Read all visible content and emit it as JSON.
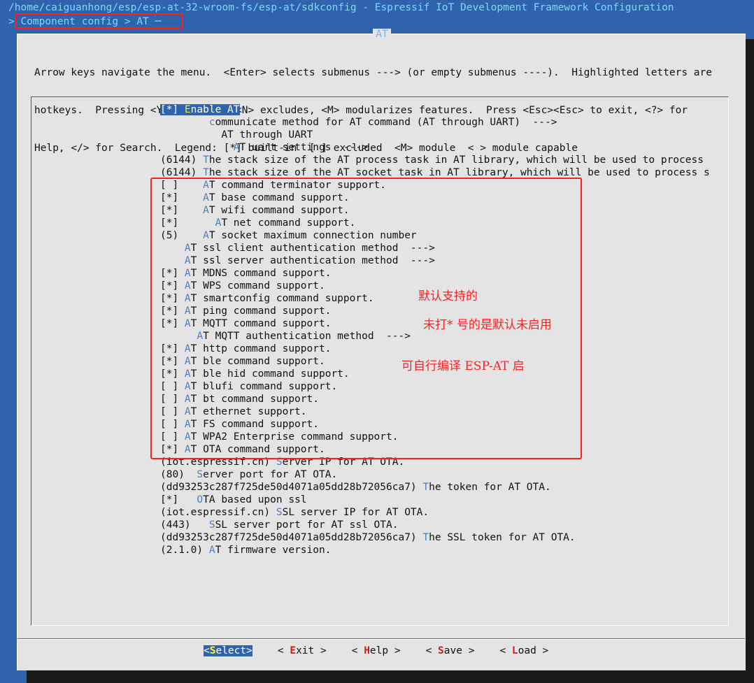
{
  "title_bar": "/home/caiguanhong/esp/esp-at-32-wroom-fs/esp-at/sdkconfig - Espressif IoT Development Framework Configuration",
  "breadcrumb": "> Component config > AT ─",
  "dialog_title": "AT",
  "help_lines": [
    "Arrow keys navigate the menu.  <Enter> selects submenus ---> (or empty submenus ----).  Highlighted letters are",
    "hotkeys.  Pressing <Y> includes, <N> excludes, <M> modularizes features.  Press <Esc><Esc> to exit, <?> for",
    "Help, </> for Search.  Legend: [*] built-in  [ ] excluded  <M> module  < > module capable"
  ],
  "menu_items": [
    {
      "pre": "[*] ",
      "hk": "E",
      "post": "nable AT",
      "selected": true
    },
    {
      "pre": "        ",
      "hk": "c",
      "post": "ommunicate method for AT command (AT through UART)  --->"
    },
    {
      "pre": "          ",
      "hk": "",
      "post": "AT through UART"
    },
    {
      "pre": "            ",
      "hk": "A",
      "post": "T uart settings  --->"
    },
    {
      "pre": "(6144) ",
      "hk": "T",
      "post": "he stack size of the AT process task in AT library, which will be used to process"
    },
    {
      "pre": "(6144) ",
      "hk": "T",
      "post": "he stack size of the AT socket task in AT library, which will be used to process s"
    },
    {
      "pre": "[ ]    ",
      "hk": "A",
      "post": "T command terminator support."
    },
    {
      "pre": "[*]    ",
      "hk": "A",
      "post": "T base command support."
    },
    {
      "pre": "[*]    ",
      "hk": "A",
      "post": "T wifi command support."
    },
    {
      "pre": "[*]      ",
      "hk": "A",
      "post": "T net command support."
    },
    {
      "pre": "(5)    ",
      "hk": "A",
      "post": "T socket maximum connection number"
    },
    {
      "pre": "    ",
      "hk": "A",
      "post": "T ssl client authentication method  --->"
    },
    {
      "pre": "    ",
      "hk": "A",
      "post": "T ssl server authentication method  --->"
    },
    {
      "pre": "[*] ",
      "hk": "A",
      "post": "T MDNS command support."
    },
    {
      "pre": "[*] ",
      "hk": "A",
      "post": "T WPS command support."
    },
    {
      "pre": "[*] ",
      "hk": "A",
      "post": "T smartconfig command support."
    },
    {
      "pre": "[*] ",
      "hk": "A",
      "post": "T ping command support."
    },
    {
      "pre": "[*] ",
      "hk": "A",
      "post": "T MQTT command support."
    },
    {
      "pre": "      ",
      "hk": "A",
      "post": "T MQTT authentication method  --->"
    },
    {
      "pre": "[*] ",
      "hk": "A",
      "post": "T http command support."
    },
    {
      "pre": "[*] ",
      "hk": "A",
      "post": "T ble command support."
    },
    {
      "pre": "[*] ",
      "hk": "A",
      "post": "T ble hid command support."
    },
    {
      "pre": "[ ] ",
      "hk": "A",
      "post": "T blufi command support."
    },
    {
      "pre": "[ ] ",
      "hk": "A",
      "post": "T bt command support."
    },
    {
      "pre": "[ ] ",
      "hk": "A",
      "post": "T ethernet support."
    },
    {
      "pre": "[ ] ",
      "hk": "A",
      "post": "T FS command support."
    },
    {
      "pre": "[ ] ",
      "hk": "A",
      "post": "T WPA2 Enterprise command support."
    },
    {
      "pre": "[*] ",
      "hk": "A",
      "post": "T OTA command support."
    },
    {
      "pre": "(iot.espressif.cn) ",
      "hk": "S",
      "post": "erver IP for AT OTA."
    },
    {
      "pre": "(80)  ",
      "hk": "S",
      "post": "erver port for AT OTA."
    },
    {
      "pre": "(dd93253c287f725de50d4071a05dd28b72056ca7) ",
      "hk": "T",
      "post": "he token for AT OTA."
    },
    {
      "pre": "[*]   ",
      "hk": "O",
      "post": "TA based upon ssl"
    },
    {
      "pre": "(iot.espressif.cn) ",
      "hk": "S",
      "post": "SL server IP for AT OTA."
    },
    {
      "pre": "(443)   ",
      "hk": "S",
      "post": "SL server port for AT ssl OTA."
    },
    {
      "pre": "(dd93253c287f725de50d4071a05dd28b72056ca7) ",
      "hk": "T",
      "post": "he SSL token for AT OTA."
    },
    {
      "pre": "(2.1.0) ",
      "hk": "A",
      "post": "T firmware version."
    }
  ],
  "annotations": {
    "line1": "默认支持的",
    "line2": "未打* 号的是默认未启用",
    "line3": "可自行编译 ESP-AT 启"
  },
  "buttons": [
    {
      "pre": "<",
      "hk": "S",
      "post": "elect>",
      "selected": true
    },
    {
      "pre": "< ",
      "hk": "E",
      "post": "xit >"
    },
    {
      "pre": "< ",
      "hk": "H",
      "post": "elp >"
    },
    {
      "pre": "< ",
      "hk": "S",
      "post": "ave >"
    },
    {
      "pre": "< ",
      "hk": "L",
      "post": "oad >"
    }
  ],
  "colors": {
    "background": "#2f64ad",
    "dialog": "#e4e4e4",
    "hotkey": "#4d7fc4",
    "annotation": "#ff1f1f"
  }
}
